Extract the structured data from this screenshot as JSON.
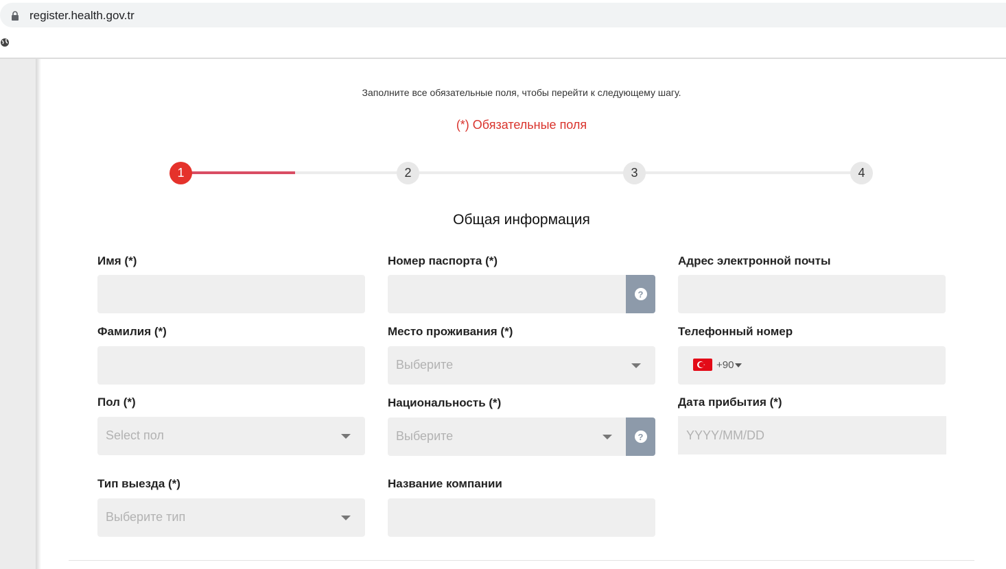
{
  "browser": {
    "url": "register.health.gov.tr"
  },
  "page": {
    "intro": "Заполните все обязательные поля, чтобы перейти к следующему шагу.",
    "required_note": "(*) Обязательные поля",
    "section_title": "Общая информация"
  },
  "stepper": {
    "steps": [
      "1",
      "2",
      "3",
      "4"
    ],
    "current_step": 1,
    "progress": 0.17,
    "colors": {
      "active": "#e5322b",
      "progress": "#d94d63"
    }
  },
  "form": {
    "first_name": {
      "label": "Имя (*)",
      "value": ""
    },
    "last_name": {
      "label": "Фамилия (*)",
      "value": ""
    },
    "gender": {
      "label": "Пол (*)",
      "placeholder": "Select пол"
    },
    "exit_type": {
      "label": "Тип выезда (*)",
      "placeholder": "Выберите тип"
    },
    "passport": {
      "label": "Номер паспорта (*)",
      "value": "",
      "help_icon": "question-circle-icon"
    },
    "residence": {
      "label": "Место проживания (*)",
      "placeholder": "Выберите"
    },
    "nationality": {
      "label": "Национальность (*)",
      "placeholder": "Выберите",
      "help_icon": "question-circle-icon"
    },
    "company": {
      "label": "Название компании",
      "value": ""
    },
    "email": {
      "label": "Адрес электронной почты",
      "value": ""
    },
    "phone": {
      "label": "Телефонный номер",
      "dial_code": "+90",
      "flag": "turkey-flag-icon"
    },
    "arrival_date": {
      "label": "Дата прибытия (*)",
      "placeholder": "YYYY/MM/DD"
    }
  }
}
